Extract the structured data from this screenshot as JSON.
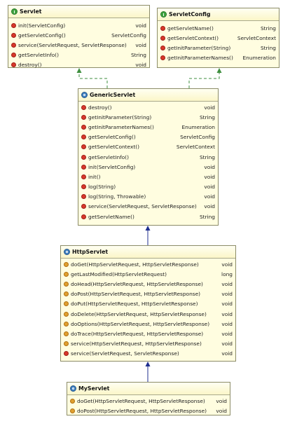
{
  "servlet": {
    "name": "Servlet",
    "methods": [
      {
        "sig": "init(ServletConfig)",
        "ret": "void"
      },
      {
        "sig": "getServletConfig()",
        "ret": "ServletConfig"
      },
      {
        "sig": "service(ServletRequest, ServletResponse)",
        "ret": "void"
      },
      {
        "sig": "getServletInfo()",
        "ret": "String"
      },
      {
        "sig": "destroy()",
        "ret": "void"
      }
    ]
  },
  "servletConfig": {
    "name": "ServletConfig",
    "methods": [
      {
        "sig": "getServletName()",
        "ret": "String"
      },
      {
        "sig": "getServletContext()",
        "ret": "ServletContext"
      },
      {
        "sig": "getInitParameter(String)",
        "ret": "String"
      },
      {
        "sig": "getInitParameterNames()",
        "ret": "Enumeration"
      }
    ]
  },
  "genericServlet": {
    "name": "GenericServlet",
    "methods": [
      {
        "sig": "destroy()",
        "ret": "void"
      },
      {
        "sig": "getInitParameter(String)",
        "ret": "String"
      },
      {
        "sig": "getInitParameterNames()",
        "ret": "Enumeration"
      },
      {
        "sig": "getServletConfig()",
        "ret": "ServletConfig"
      },
      {
        "sig": "getServletContext()",
        "ret": "ServletContext"
      },
      {
        "sig": "getServletInfo()",
        "ret": "String"
      },
      {
        "sig": "init(ServletConfig)",
        "ret": "void"
      },
      {
        "sig": "init()",
        "ret": "void"
      },
      {
        "sig": "log(String)",
        "ret": "void"
      },
      {
        "sig": "log(String, Throwable)",
        "ret": "void"
      },
      {
        "sig": "service(ServletRequest, ServletResponse)",
        "ret": "void"
      },
      {
        "sig": "getServletName()",
        "ret": "String"
      }
    ]
  },
  "httpServlet": {
    "name": "HttpServlet",
    "methods": [
      {
        "sig": "doGet(HttpServletRequest, HttpServletResponse)",
        "ret": "void"
      },
      {
        "sig": "getLastModified(HttpServletRequest)",
        "ret": "long"
      },
      {
        "sig": "doHead(HttpServletRequest, HttpServletResponse)",
        "ret": "void"
      },
      {
        "sig": "doPost(HttpServletRequest, HttpServletResponse)",
        "ret": "void"
      },
      {
        "sig": "doPut(HttpServletRequest, HttpServletResponse)",
        "ret": "void"
      },
      {
        "sig": "doDelete(HttpServletRequest, HttpServletResponse)",
        "ret": "void"
      },
      {
        "sig": "doOptions(HttpServletRequest, HttpServletResponse)",
        "ret": "void"
      },
      {
        "sig": "doTrace(HttpServletRequest, HttpServletResponse)",
        "ret": "void"
      },
      {
        "sig": "service(HttpServletRequest, HttpServletResponse)",
        "ret": "void"
      },
      {
        "sig": "service(ServletRequest, ServletResponse)",
        "ret": "void"
      }
    ]
  },
  "myServlet": {
    "name": "MyServlet",
    "methods": [
      {
        "sig": "doGet(HttpServletRequest, HttpServletResponse)",
        "ret": "void"
      },
      {
        "sig": "doPost(HttpServletRequest, HttpServletResponse)",
        "ret": "void"
      }
    ]
  },
  "colors": {
    "box_fill": "#fffde0",
    "implements_arrow": "#3f8f3f",
    "extends_arrow": "#1f2f8f"
  },
  "icons": {
    "interface": "interface-icon",
    "class": "class-icon",
    "method": "method-icon"
  }
}
